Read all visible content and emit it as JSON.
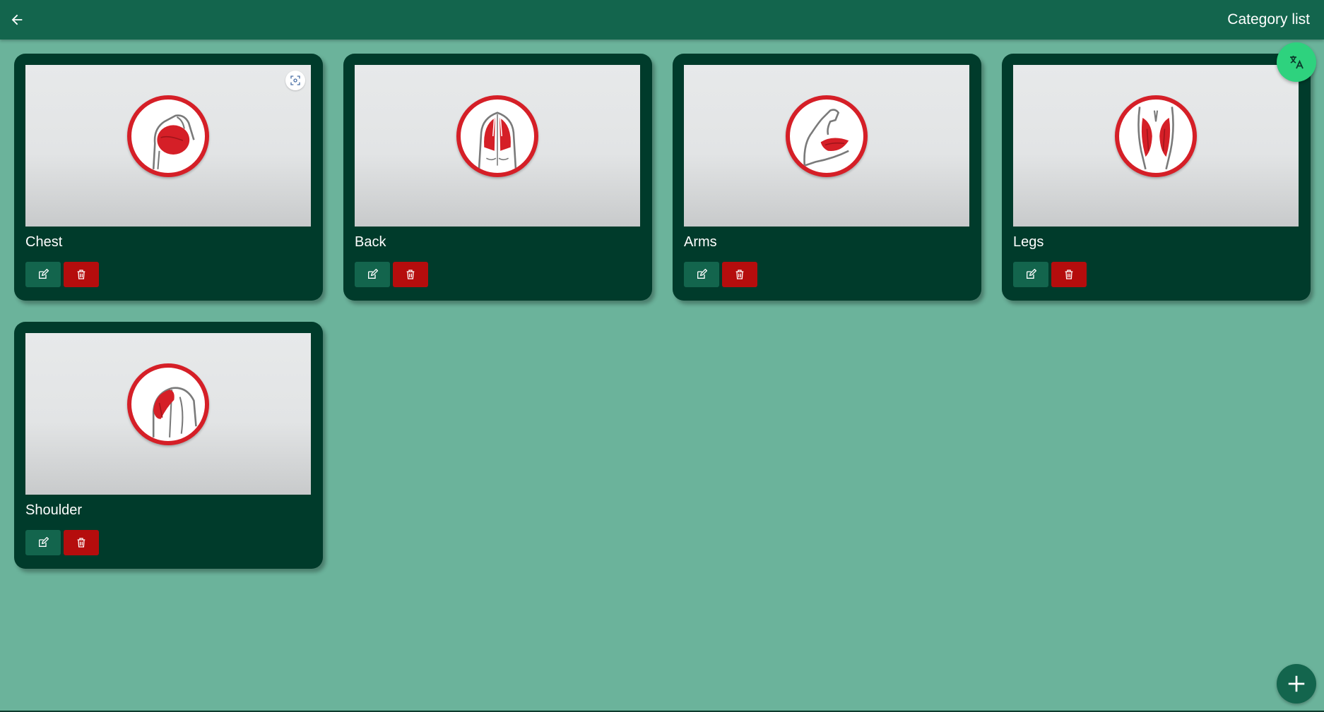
{
  "header": {
    "title": "Category list",
    "back_icon": "arrow-left-icon"
  },
  "categories": [
    {
      "name": "Chest",
      "muscle": "chest",
      "show_scan_badge": true
    },
    {
      "name": "Back",
      "muscle": "back",
      "show_scan_badge": false
    },
    {
      "name": "Arms",
      "muscle": "arms",
      "show_scan_badge": false
    },
    {
      "name": "Legs",
      "muscle": "legs",
      "show_scan_badge": false
    },
    {
      "name": "Shoulder",
      "muscle": "shoulder",
      "show_scan_badge": false
    }
  ],
  "actions": {
    "edit_icon": "edit-icon",
    "delete_icon": "trash-icon",
    "add_icon": "plus-icon",
    "translate_icon": "translate-icon"
  },
  "colors": {
    "background": "#6bb39b",
    "topbar": "#13654d",
    "card": "#003b2b",
    "delete": "#b50d0d",
    "translate_fab": "#2ed27e",
    "muscle_red": "#d51f27"
  }
}
